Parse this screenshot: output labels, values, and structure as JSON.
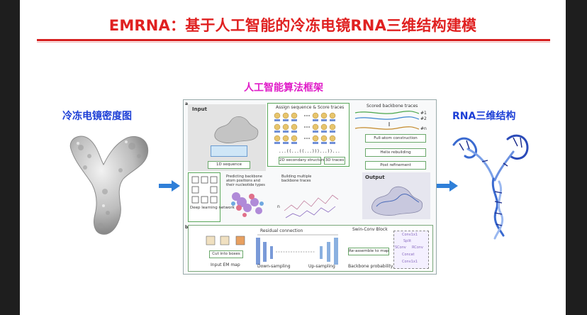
{
  "slide": {
    "title": "EMRNA：基于人工智能的冷冻电镜RNA三维结构建模",
    "left_label": "冷冻电镜密度图",
    "center_label": "人工智能算法框架",
    "right_label": "RNA三维结构"
  },
  "figure": {
    "panel_a": "a",
    "panel_b": "b",
    "input": "Input",
    "sequence_1d": "1D sequence",
    "assign_title": "Assign sequence & Score traces",
    "secondary_2d": "2D secondary structure",
    "traces_3d": "3D traces",
    "scored_title": "Scored backbone traces",
    "trace_1": "#1",
    "trace_2": "#2",
    "trace_n": "#n",
    "full_atom": "Full-atom construction",
    "helix": "Helix rebuilding",
    "post": "Post refinement",
    "predicting": "Predicting backbone atom positions and their nucleotide types",
    "building": "Building multiple backbone traces",
    "n_label": "n",
    "deep_learning": "Deep learning network",
    "output": "Output",
    "cut_boxes": "Cut into boxes",
    "input_em": "Input EM map",
    "residual": "Residual connection",
    "down": "Down-sampling",
    "up": "Up-sampling",
    "swin": "Swin-Conv Block",
    "reassemble": "Re-assemble to map",
    "backbone_prob": "Backbone probability map",
    "dots": "...((...((...)))...))...",
    "swin_items": [
      "Conv1x1",
      "Split",
      "SConv",
      "RConv",
      "Concat",
      "Conv1x1"
    ]
  }
}
